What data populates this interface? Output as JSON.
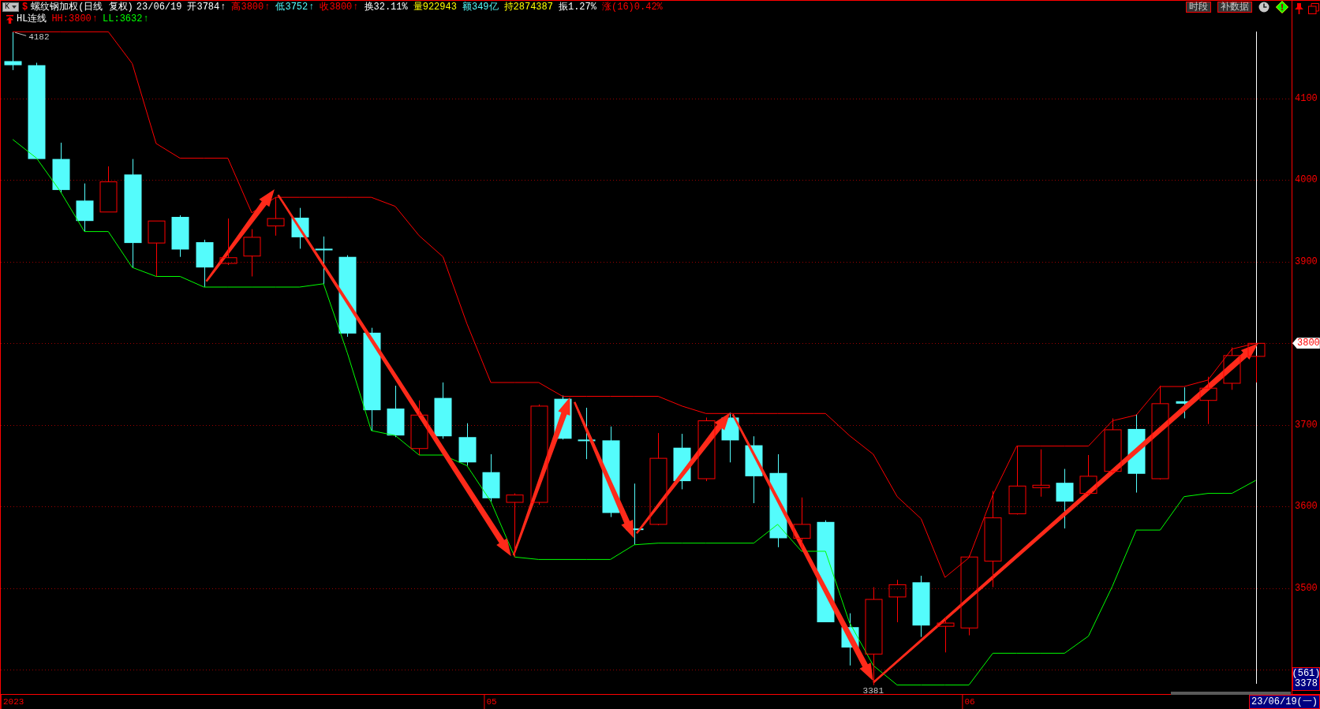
{
  "header": {
    "period_button": {
      "label": "K"
    },
    "symbol_mark": "$",
    "title": "螺纹钢加权(日线 复权)",
    "date": "23/06/19",
    "quotes": [
      {
        "text": "开3784",
        "arrow": "↑",
        "color": "#ffffff"
      },
      {
        "text": "高3800",
        "arrow": "↑",
        "color": "#ff0000"
      },
      {
        "text": "低3752",
        "arrow": "↑",
        "color": "#54fcfc"
      },
      {
        "text": "收3800",
        "arrow": "↑",
        "color": "#ff0000"
      },
      {
        "text": "换32.11%",
        "color": "#ffffff"
      },
      {
        "text": "量922943",
        "color": "#ffff00"
      },
      {
        "text": "额349亿",
        "color": "#54fcfc"
      },
      {
        "text": "持2874387",
        "color": "#ffff00"
      },
      {
        "text": "振1.27%",
        "color": "#ffffff"
      },
      {
        "text": "涨(16)0.42%",
        "color": "#ff0000"
      }
    ],
    "buttons": [
      {
        "label": "时段"
      },
      {
        "label": "补数据"
      }
    ]
  },
  "indicator": {
    "name": "HL连线",
    "values": [
      {
        "text": "HH:3800",
        "arrow": "↑",
        "color": "#ff0000"
      },
      {
        "text": "LL:3632",
        "arrow": "↑",
        "color": "#00ff00"
      }
    ]
  },
  "chart": {
    "chart_data": {
      "type": "candlestick",
      "categories": [
        "2023",
        null,
        null,
        null,
        null,
        null,
        null,
        null,
        null,
        null,
        null,
        null,
        null,
        null,
        null,
        null,
        null,
        null,
        null,
        null,
        "05",
        null,
        null,
        null,
        null,
        null,
        null,
        null,
        null,
        null,
        null,
        null,
        null,
        null,
        null,
        null,
        null,
        null,
        null,
        null,
        "06",
        null,
        null,
        null,
        null,
        null,
        null,
        null,
        null,
        null,
        null,
        null,
        null
      ],
      "ylim": [
        3370,
        4190
      ],
      "yticks": [
        3500,
        3600,
        3700,
        3800,
        3900,
        4000,
        4100
      ],
      "grid": true,
      "series": [
        {
          "ohlc": [
            [
              4146,
              4182,
              4135,
              4141
            ],
            [
              4141,
              4144,
              4026,
              4026
            ],
            [
              4026,
              4046,
              3984,
              3988
            ],
            [
              3975,
              3996,
              3937,
              3950
            ],
            [
              3961,
              4017,
              3961,
              3998
            ],
            [
              4007,
              4026,
              3893,
              3923
            ],
            [
              3923,
              3950,
              3882,
              3950
            ],
            [
              3955,
              3957,
              3906,
              3915
            ],
            [
              3924,
              3927,
              3869,
              3893
            ],
            [
              3898,
              3953,
              3896,
              3905
            ],
            [
              3907,
              3940,
              3882,
              3930
            ],
            [
              3944,
              3979,
              3932,
              3953
            ],
            [
              3954,
              3966,
              3916,
              3930
            ],
            [
              3916,
              3931,
              3873,
              3914
            ],
            [
              3906,
              3908,
              3808,
              3812
            ],
            [
              3813,
              3819,
              3693,
              3718
            ],
            [
              3720,
              3748,
              3685,
              3687
            ],
            [
              3671,
              3730,
              3663,
              3712
            ],
            [
              3733,
              3752,
              3683,
              3686
            ],
            [
              3685,
              3702,
              3650,
              3654
            ],
            [
              3642,
              3664,
              3606,
              3610
            ],
            [
              3605,
              3616,
              3538,
              3614
            ],
            [
              3605,
              3725,
              3602,
              3723
            ],
            [
              3732,
              3736,
              3682,
              3683
            ],
            [
              3682,
              3721,
              3658,
              3680
            ],
            [
              3681,
              3698,
              3587,
              3592
            ],
            [
              3573,
              3628,
              3553,
              3571
            ],
            [
              3578,
              3690,
              3577,
              3659
            ],
            [
              3672,
              3689,
              3621,
              3631
            ],
            [
              3634,
              3709,
              3631,
              3705
            ],
            [
              3709,
              3715,
              3654,
              3681
            ],
            [
              3675,
              3686,
              3604,
              3637
            ],
            [
              3641,
              3664,
              3550,
              3561
            ],
            [
              3561,
              3611,
              3549,
              3578
            ],
            [
              3581,
              3583,
              3458,
              3458
            ],
            [
              3452,
              3469,
              3405,
              3427
            ],
            [
              3419,
              3501,
              3381,
              3486
            ],
            [
              3489,
              3510,
              3458,
              3504
            ],
            [
              3507,
              3515,
              3440,
              3454
            ],
            [
              3453,
              3464,
              3421,
              3457
            ],
            [
              3451,
              3540,
              3442,
              3538
            ],
            [
              3533,
              3619,
              3501,
              3586
            ],
            [
              3591,
              3674,
              3590,
              3625
            ],
            [
              3623,
              3670,
              3612,
              3626
            ],
            [
              3629,
              3646,
              3573,
              3606
            ],
            [
              3616,
              3663,
              3613,
              3637
            ],
            [
              3643,
              3708,
              3641,
              3694
            ],
            [
              3695,
              3713,
              3617,
              3640
            ],
            [
              3634,
              3748,
              3633,
              3726
            ],
            [
              3729,
              3746,
              3708,
              3726
            ],
            [
              3730,
              3759,
              3701,
              3745
            ],
            [
              3751,
              3795,
              3743,
              3785
            ],
            [
              3784,
              3800,
              3752,
              3800
            ]
          ]
        },
        {
          "type": "line",
          "color": "#ff0000",
          "values": [
            4182,
            4182,
            4182,
            4182,
            4182,
            4143,
            4045,
            4027,
            4027,
            4027,
            3960,
            3979,
            3979,
            3979,
            3979,
            3979,
            3968,
            3932,
            3906,
            3824,
            3752,
            3752,
            3752,
            3735,
            3735,
            3735,
            3735,
            3735,
            3723,
            3714,
            3714,
            3714,
            3714,
            3714,
            3714,
            3687,
            3664,
            3612,
            3585,
            3513,
            3537,
            3614,
            3674,
            3674,
            3674,
            3674,
            3705,
            3712,
            3747,
            3747,
            3755,
            3793,
            3800
          ]
        },
        {
          "type": "line",
          "color": "#00ff00",
          "values": [
            4050,
            4027,
            3986,
            3937,
            3937,
            3893,
            3882,
            3882,
            3869,
            3869,
            3869,
            3869,
            3869,
            3873,
            3788,
            3693,
            3687,
            3663,
            3663,
            3650,
            3606,
            3538,
            3535,
            3535,
            3535,
            3535,
            3553,
            3555,
            3555,
            3555,
            3555,
            3555,
            3578,
            3545,
            3545,
            3458,
            3405,
            3381,
            3381,
            3381,
            3381,
            3420,
            3420,
            3420,
            3420,
            3441,
            3502,
            3571,
            3571,
            3612,
            3616,
            3616,
            3632
          ]
        }
      ],
      "annotations": [
        {
          "text": "4182",
          "y": 4182
        },
        {
          "text": "3381",
          "y": 3381
        }
      ]
    }
  },
  "y_axis": {
    "cursor_box": [
      "(561)",
      "3378"
    ]
  },
  "x_axis": {
    "cursor_date": "23/06/19(一)"
  }
}
